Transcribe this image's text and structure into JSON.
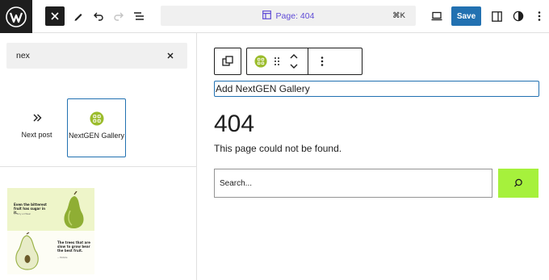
{
  "toolbar": {
    "page_title": "Page: 404",
    "shortcut": "⌘K",
    "save_label": "Save"
  },
  "inserter": {
    "search_value": "nex",
    "blocks": [
      {
        "label": "Next post"
      },
      {
        "label": "NextGEN Gallery"
      }
    ],
    "pattern": {
      "heading_top": "Even the bitterest fruit has sugar in it.",
      "caption_top": "— Terry a O'Neal",
      "heading_bottom": "The trees that are slow to grow bear the best fruit.",
      "caption_bottom": "— Molière"
    }
  },
  "editor": {
    "selected_block_text": "Add NextGEN Gallery",
    "heading": "404",
    "paragraph": "This page could not be found.",
    "search_placeholder": "Search..."
  },
  "colors": {
    "accent": "#2271b1",
    "nextgen_green": "#9bbc2c",
    "search_button": "#a6f13c",
    "command_text": "#5f4bd6"
  }
}
